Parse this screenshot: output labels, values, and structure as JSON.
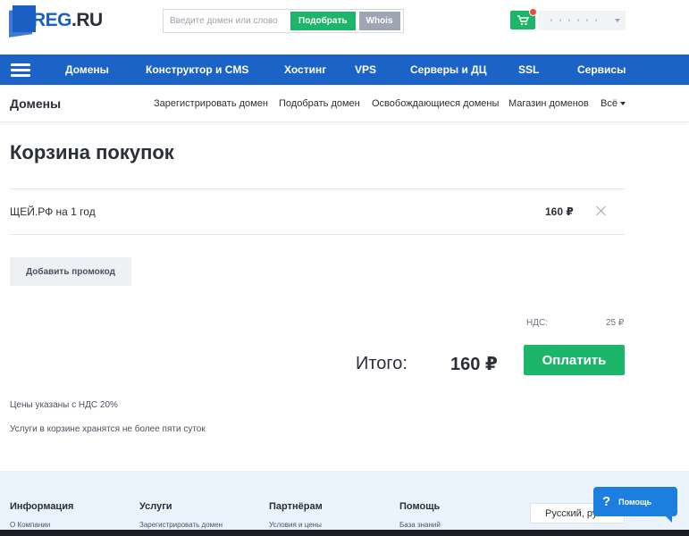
{
  "header": {
    "logo_main": "REG",
    "logo_dot": ".",
    "logo_tld": "RU",
    "search_placeholder": "Введите домен или слово",
    "pick_label": "Подобрать",
    "whois_label": "Whois",
    "cart_badge_color": "#e74c3c"
  },
  "mainnav": {
    "items": [
      "Домены",
      "Конструктор и CMS",
      "Хостинг",
      "VPS",
      "Серверы и ДЦ",
      "SSL",
      "Сервисы"
    ]
  },
  "subnav": {
    "title": "Домены",
    "links": [
      "Зарегистрировать домен",
      "Подобрать домен",
      "Освобождающиеся домены",
      "Магазин доменов",
      "Всё"
    ]
  },
  "cart": {
    "title": "Корзина покупок",
    "items": [
      {
        "name": "ЩЕЙ.РФ на 1 год",
        "price": "160 ₽"
      }
    ],
    "promo_label": "Добавить промокод",
    "vat_label": "НДС:",
    "vat_value": "25 ₽",
    "total_label": "Итого:",
    "total_value": "160 ₽",
    "pay_label": "Оплатить",
    "notes": [
      "Цены указаны с НДС 20%",
      "Услуги в корзине хранятся не более пяти суток"
    ]
  },
  "footer": {
    "columns": [
      {
        "title": "Информация",
        "link": "О Компании"
      },
      {
        "title": "Услуги",
        "link": "Зарегистрировать домен"
      },
      {
        "title": "Партнёрам",
        "link": "Условия и цены"
      },
      {
        "title": "Помощь",
        "link": "База знаний"
      }
    ],
    "language": "Русский, ру",
    "help_label": "Помощь",
    "help_icon": "?"
  },
  "colors": {
    "brand_blue": "#1c63c7",
    "accent_green": "#1db56a",
    "footer_bg": "#eaf3fc"
  }
}
